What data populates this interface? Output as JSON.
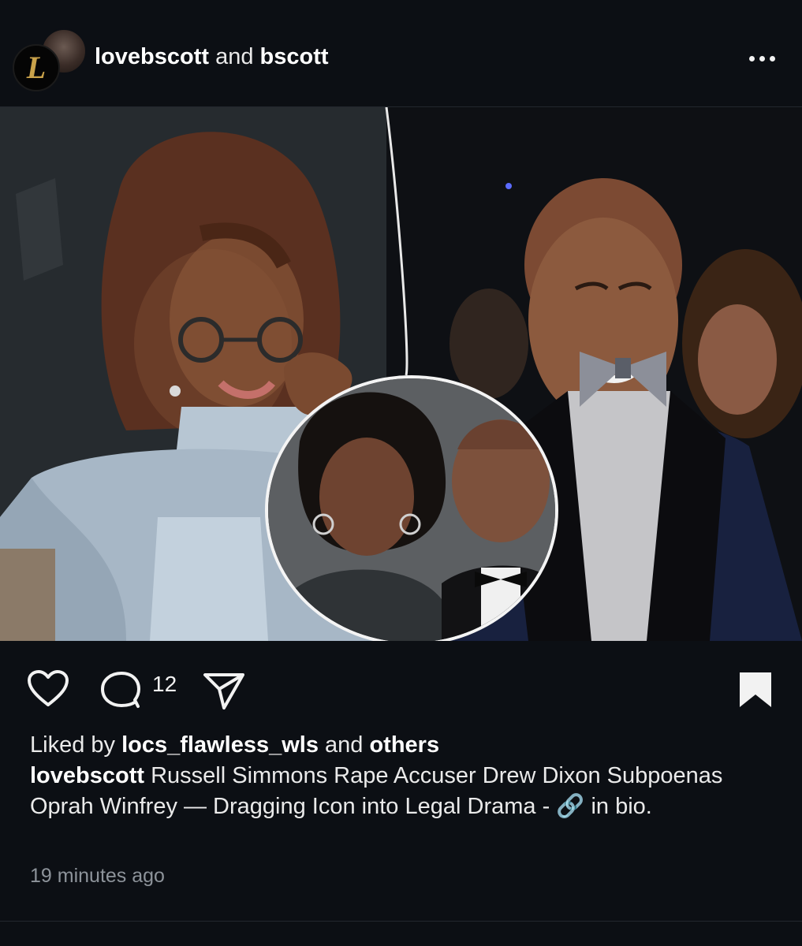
{
  "post": {
    "avatar_letter": "L",
    "author": "lovebscott",
    "joiner": "and",
    "coauthor": "bscott",
    "more_icon": "more-horizontal-icon",
    "comment_count": "12",
    "liked_by_prefix": "Liked by",
    "liked_by_user": "locs_flawless_wls",
    "liked_by_joiner": "and",
    "liked_by_others": "others",
    "caption_author": "lovebscott",
    "caption_text": "Russell Simmons Rape Accuser Drew Dixon Subpoenas Oprah Winfrey — Dragging Icon into Legal Drama - 🔗 in bio.",
    "timestamp": "19 minutes ago"
  },
  "icons": [
    "heart-icon",
    "comment-icon",
    "send-icon",
    "bookmark-icon"
  ],
  "colors": {
    "background": "#0c0f14",
    "text": "#f2f2f2",
    "muted": "#8d939a",
    "avatar_gold": "#c9a24a"
  }
}
